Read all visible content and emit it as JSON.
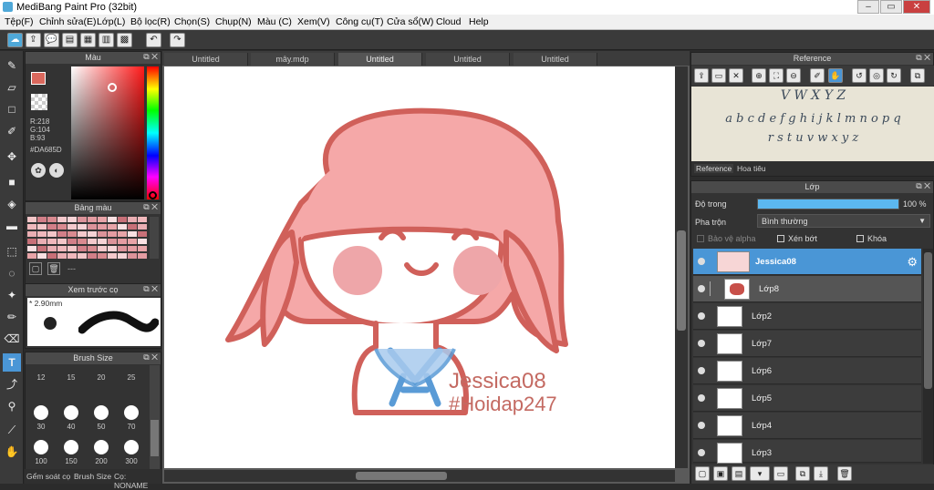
{
  "window": {
    "title": "MediBang Paint Pro (32bit)"
  },
  "menu": [
    "Tệp(F)",
    "Chỉnh sửa(E)",
    "Lớp(L)",
    "Bộ lọc(R)",
    "Chọn(S)",
    "Chụp(N)",
    "Màu (C)",
    "Xem(V)",
    "Công cụ(T)",
    "Cửa sổ(W)",
    "Cloud",
    "Help"
  ],
  "color_panel": {
    "title": "Màu",
    "r": "R:218",
    "g": "G:104",
    "b": "B:93",
    "hex": "#DA685D",
    "primary": "#da685d"
  },
  "palette_panel": {
    "title": "Bảng màu",
    "dash": "---"
  },
  "brush_preview": {
    "title": "Xem trước cọ",
    "size": "* 2.90mm"
  },
  "brush_size": {
    "title": "Brush Size",
    "sizes": [
      "12",
      "15",
      "20",
      "25",
      "30",
      "40",
      "50",
      "70",
      "100",
      "150",
      "200",
      "300"
    ]
  },
  "bottom_tabs": [
    "Gểm soát cọ",
    "Brush Size",
    "Cọ: NONAME"
  ],
  "doc_tabs": [
    "Untitled",
    "mây.mdp",
    "Untitled",
    "Untitled",
    "Untitled"
  ],
  "canvas_text": {
    "line1": "Jessica08",
    "line2": "#Hoidap247"
  },
  "reference": {
    "title": "Reference",
    "line1": "V W X Y Z",
    "line2": "a b c d e f g h i j k l m n o p q",
    "line3": "r s t u v w x y z",
    "tab1": "Reference",
    "tab2": "Hoa tiêu"
  },
  "layer_panel": {
    "title": "Lớp",
    "opacity_label": "Độ trong",
    "opacity_value": "100 %",
    "opacity": 1.0,
    "blend_label": "Pha trộn",
    "blend_value": "Bình thường",
    "protect_alpha": "Bảo vệ alpha",
    "clipping": "Xén bớt",
    "lock": "Khóa",
    "layers": [
      {
        "name": "Jessica08",
        "selected": true
      },
      {
        "name": "Lớp8"
      },
      {
        "name": "Lớp2"
      },
      {
        "name": "Lớp7"
      },
      {
        "name": "Lớp6"
      },
      {
        "name": "Lớp5"
      },
      {
        "name": "Lớp4"
      },
      {
        "name": "Lớp3"
      }
    ]
  },
  "colors": {
    "accent": "#4a96d6",
    "line": "#d0605a",
    "hair": "#f5a8a8",
    "cheek": "#eea6a9",
    "collar": "#5a9bd6"
  }
}
